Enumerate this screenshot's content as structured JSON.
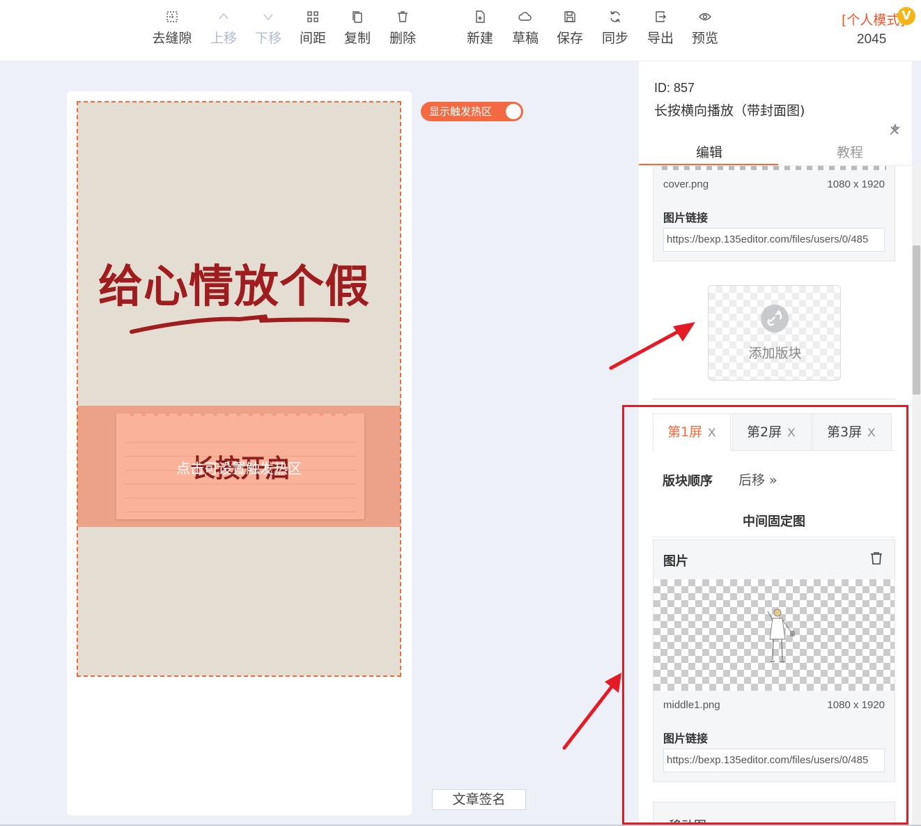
{
  "toolbar": {
    "items": [
      {
        "label": "去缝隙",
        "icon": "grid-icon",
        "disabled": false
      },
      {
        "label": "上移",
        "icon": "chevron-up-icon",
        "disabled": true
      },
      {
        "label": "下移",
        "icon": "chevron-down-icon",
        "disabled": true
      },
      {
        "label": "间距",
        "icon": "spacing-icon",
        "disabled": false
      },
      {
        "label": "复制",
        "icon": "copy-icon",
        "disabled": false
      },
      {
        "label": "删除",
        "icon": "trash-icon",
        "disabled": false
      },
      {
        "label": "新建",
        "icon": "new-file-icon",
        "disabled": false
      },
      {
        "label": "草稿",
        "icon": "cloud-icon",
        "disabled": false
      },
      {
        "label": "保存",
        "icon": "save-icon",
        "disabled": false
      },
      {
        "label": "同步",
        "icon": "sync-icon",
        "disabled": false
      },
      {
        "label": "导出",
        "icon": "export-icon",
        "disabled": false
      },
      {
        "label": "预览",
        "icon": "eye-icon",
        "disabled": false
      }
    ],
    "mode_label": "[个人模式]",
    "vip_badge": "V",
    "count": "2045"
  },
  "canvas": {
    "poster_title": "给心情放个假",
    "note_title": "长按开启",
    "hotzone_hint": "点击可设置触发热区",
    "toggle_label": "显示触发热区",
    "toggle_on": true,
    "signature_button": "文章签名"
  },
  "panel": {
    "id_label": "ID: 857",
    "template_name": "长按横向播放（带封面图)",
    "tabs": {
      "edit": "编辑",
      "tutorial": "教程"
    },
    "cover": {
      "file_name": "cover.png",
      "size": "1080 x 1920",
      "link_label": "图片链接",
      "link_value": "https://bexp.135editor.com/files/users/0/485"
    },
    "add_block_label": "添加版块",
    "screen_tabs": [
      {
        "label": "第1屏",
        "close": "X",
        "active": true
      },
      {
        "label": "第2屏",
        "close": "X",
        "active": false
      },
      {
        "label": "第3屏",
        "close": "X",
        "active": false
      }
    ],
    "order_label": "版块顺序",
    "move_back_label": "后移 »",
    "section_title": "中间固定图",
    "middle_image": {
      "heading": "图片",
      "file_name": "middle1.png",
      "size": "1080 x 1920",
      "link_label": "图片链接",
      "link_value": "https://bexp.135editor.com/files/users/0/485"
    },
    "next_card_label": "移动图",
    "next_card_chevron": "⌄"
  },
  "colors": {
    "accent": "#f06a3a",
    "poster_bg": "#e3ded1",
    "poster_title": "#9f1c1f",
    "highlight_red": "#e41b25"
  }
}
